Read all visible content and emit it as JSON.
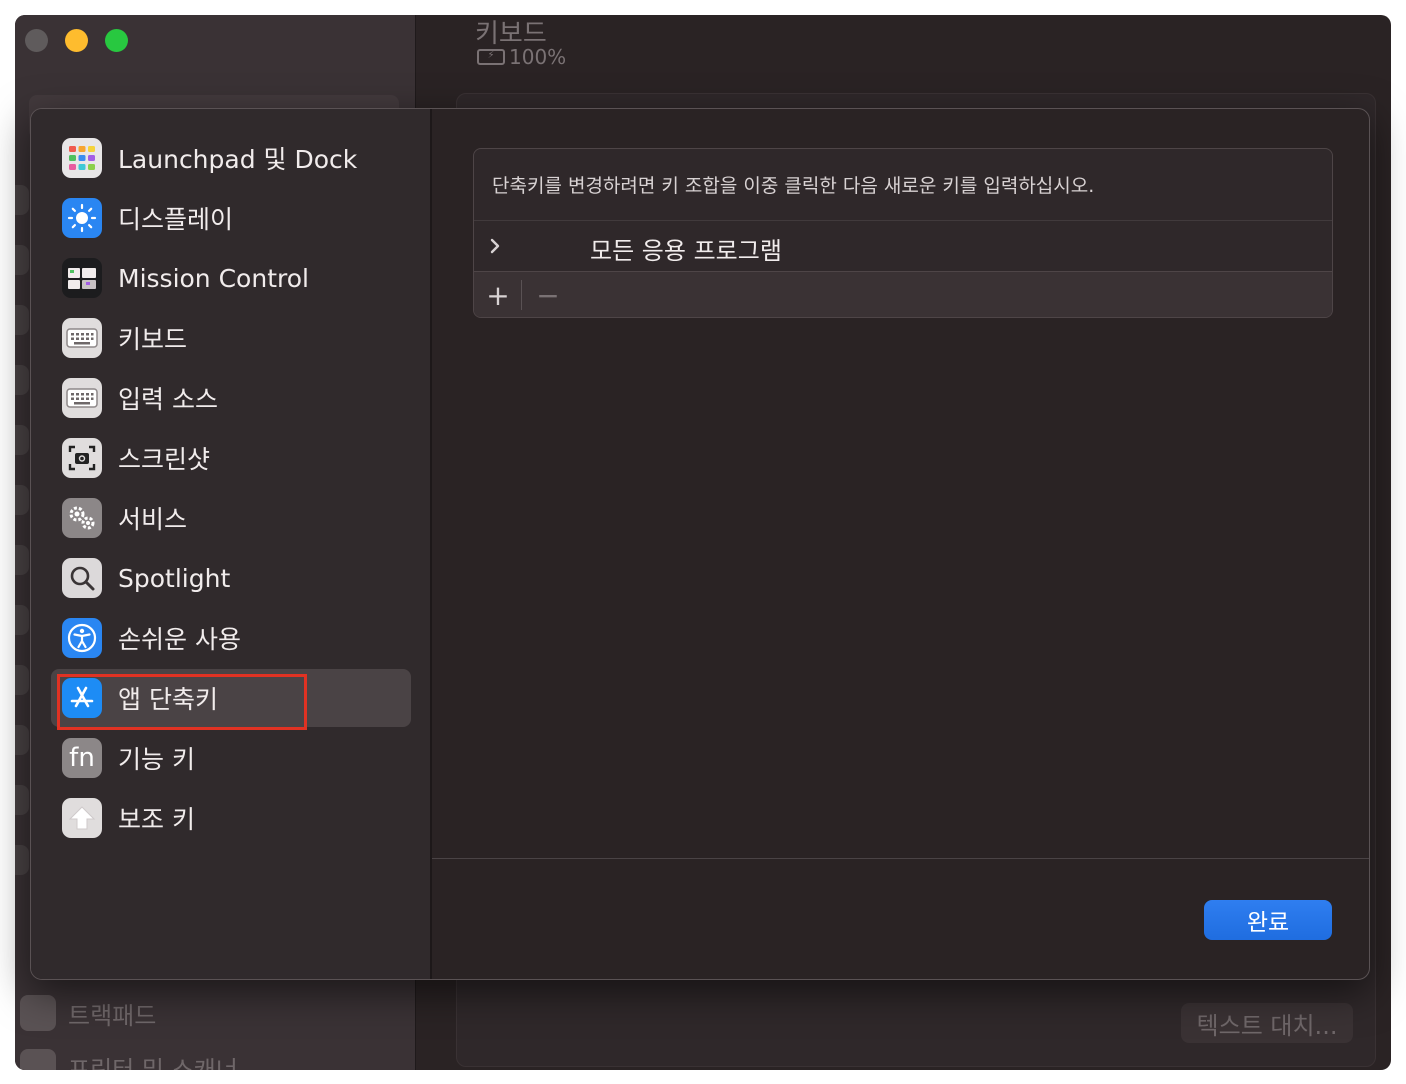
{
  "background": {
    "header_title": "키보드",
    "battery_level": "100%",
    "sidebar_items": [
      "트랙패드",
      "프린터 및 스캐너"
    ],
    "text_replacement_button": "텍스트 대치..."
  },
  "sheet": {
    "sidebar": {
      "items": [
        {
          "label": "Launchpad 및 Dock",
          "icon": "launchpad-dock-icon",
          "selected": false
        },
        {
          "label": "디스플레이",
          "icon": "display-brightness-icon",
          "selected": false
        },
        {
          "label": "Mission Control",
          "icon": "mission-control-icon",
          "selected": false
        },
        {
          "label": "키보드",
          "icon": "keyboard-icon",
          "selected": false
        },
        {
          "label": "입력 소스",
          "icon": "input-source-icon",
          "selected": false
        },
        {
          "label": "스크린샷",
          "icon": "screenshot-icon",
          "selected": false
        },
        {
          "label": "서비스",
          "icon": "services-gears-icon",
          "selected": false
        },
        {
          "label": "Spotlight",
          "icon": "spotlight-search-icon",
          "selected": false
        },
        {
          "label": "손쉬운 사용",
          "icon": "accessibility-icon",
          "selected": false
        },
        {
          "label": "앱 단축키",
          "icon": "app-store-icon",
          "selected": true
        },
        {
          "label": "기능 키",
          "icon": "fn-key-icon",
          "selected": false
        },
        {
          "label": "보조 키",
          "icon": "modifier-key-icon",
          "selected": false
        }
      ]
    },
    "content": {
      "instruction": "단축키를 변경하려면 키 조합을 이중 클릭한 다음 새로운 키를 입력하십시오.",
      "tree_row_label": "모든 응용 프로그램",
      "add_symbol": "+",
      "remove_symbol": "−"
    },
    "done_button": "완료"
  },
  "colors": {
    "accent": "#2f7ef0",
    "highlight_box": "#e03223",
    "traffic_close": "#5f5b5c",
    "traffic_minimize": "#febc2e",
    "traffic_maximize": "#28c840"
  }
}
